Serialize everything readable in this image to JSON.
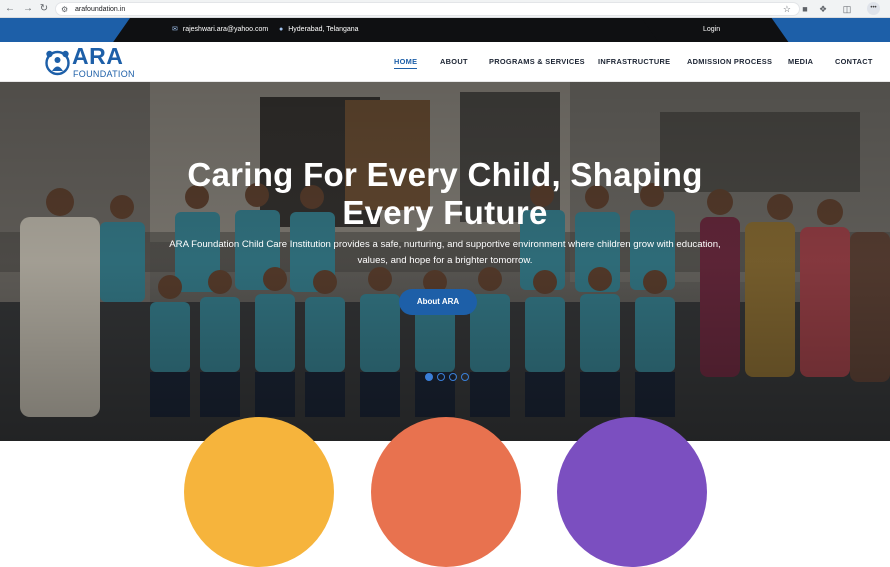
{
  "browser": {
    "url": "arafoundation.in",
    "menu_label": "•••"
  },
  "topbar": {
    "email": "rajeshwari.ara@yahoo.com",
    "location": "Hyderabad, Telangana",
    "login_label": "Login"
  },
  "logo": {
    "title": "ARA",
    "subtitle": "FOUNDATION"
  },
  "menu": {
    "items": [
      {
        "label": "HOME",
        "active": true
      },
      {
        "label": "ABOUT",
        "active": false
      },
      {
        "label": "PROGRAMS & SERVICES",
        "active": false
      },
      {
        "label": "INFRASTRUCTURE",
        "active": false
      },
      {
        "label": "ADMISSION PROCESS",
        "active": false
      },
      {
        "label": "MEDIA",
        "active": false
      },
      {
        "label": "CONTACT",
        "active": false
      }
    ]
  },
  "hero": {
    "title_line1": "Caring For Every Child, Shaping",
    "title_line2": "Every Future",
    "text_line1": "ARA Foundation Child Care Institution provides a safe, nurturing, and supportive environment where children grow with education,",
    "text_line2": "values, and hope for a brighter tomorrow.",
    "button_label": "About ARA",
    "slides_total": 4,
    "active_slide": 1
  },
  "colors": {
    "brand_blue": "#1d5fa8",
    "topbar_dark": "#0f1012",
    "circle_yellow": "#f6b43c",
    "circle_orange": "#e8724f",
    "circle_purple": "#7b4fc0"
  },
  "icons": {
    "back": "arrow-left-icon",
    "forward": "arrow-right-icon",
    "reload": "reload-icon",
    "site": "site-info-icon",
    "bookmark": "star-icon",
    "email": "envelope-icon",
    "location": "map-pin-icon"
  }
}
